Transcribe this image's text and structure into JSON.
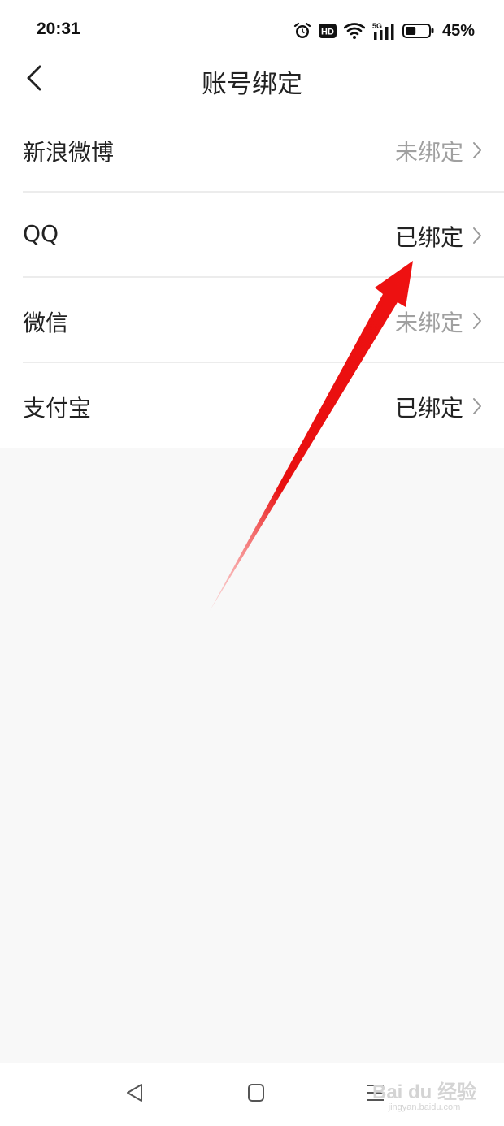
{
  "status_bar": {
    "time": "20:31",
    "battery_percent": "45%",
    "network_label": "5G",
    "hd_label": "HD",
    "battery_level": 0.45,
    "icons": [
      "alarm-icon",
      "hd-icon",
      "wifi-icon",
      "signal-5g-icon",
      "battery-icon"
    ]
  },
  "header": {
    "title": "账号绑定",
    "back_icon": "chevron-left-icon"
  },
  "bindings": [
    {
      "label": "新浪微博",
      "status": "未绑定",
      "bound": false
    },
    {
      "label": "QQ",
      "status": "已绑定",
      "bound": true
    },
    {
      "label": "微信",
      "status": "未绑定",
      "bound": false
    },
    {
      "label": "支付宝",
      "status": "已绑定",
      "bound": true
    }
  ],
  "colors": {
    "bound_text": "#222222",
    "unbound_text": "#a0a0a0",
    "annotation_arrow": "#ee1111",
    "page_background": "#f8f8f8"
  },
  "system_nav": {
    "icons": [
      "back-triangle-icon",
      "home-square-icon",
      "menu-lines-icon"
    ]
  },
  "watermark": {
    "main": "Bai du 经验",
    "sub": "jingyan.baidu.com"
  }
}
